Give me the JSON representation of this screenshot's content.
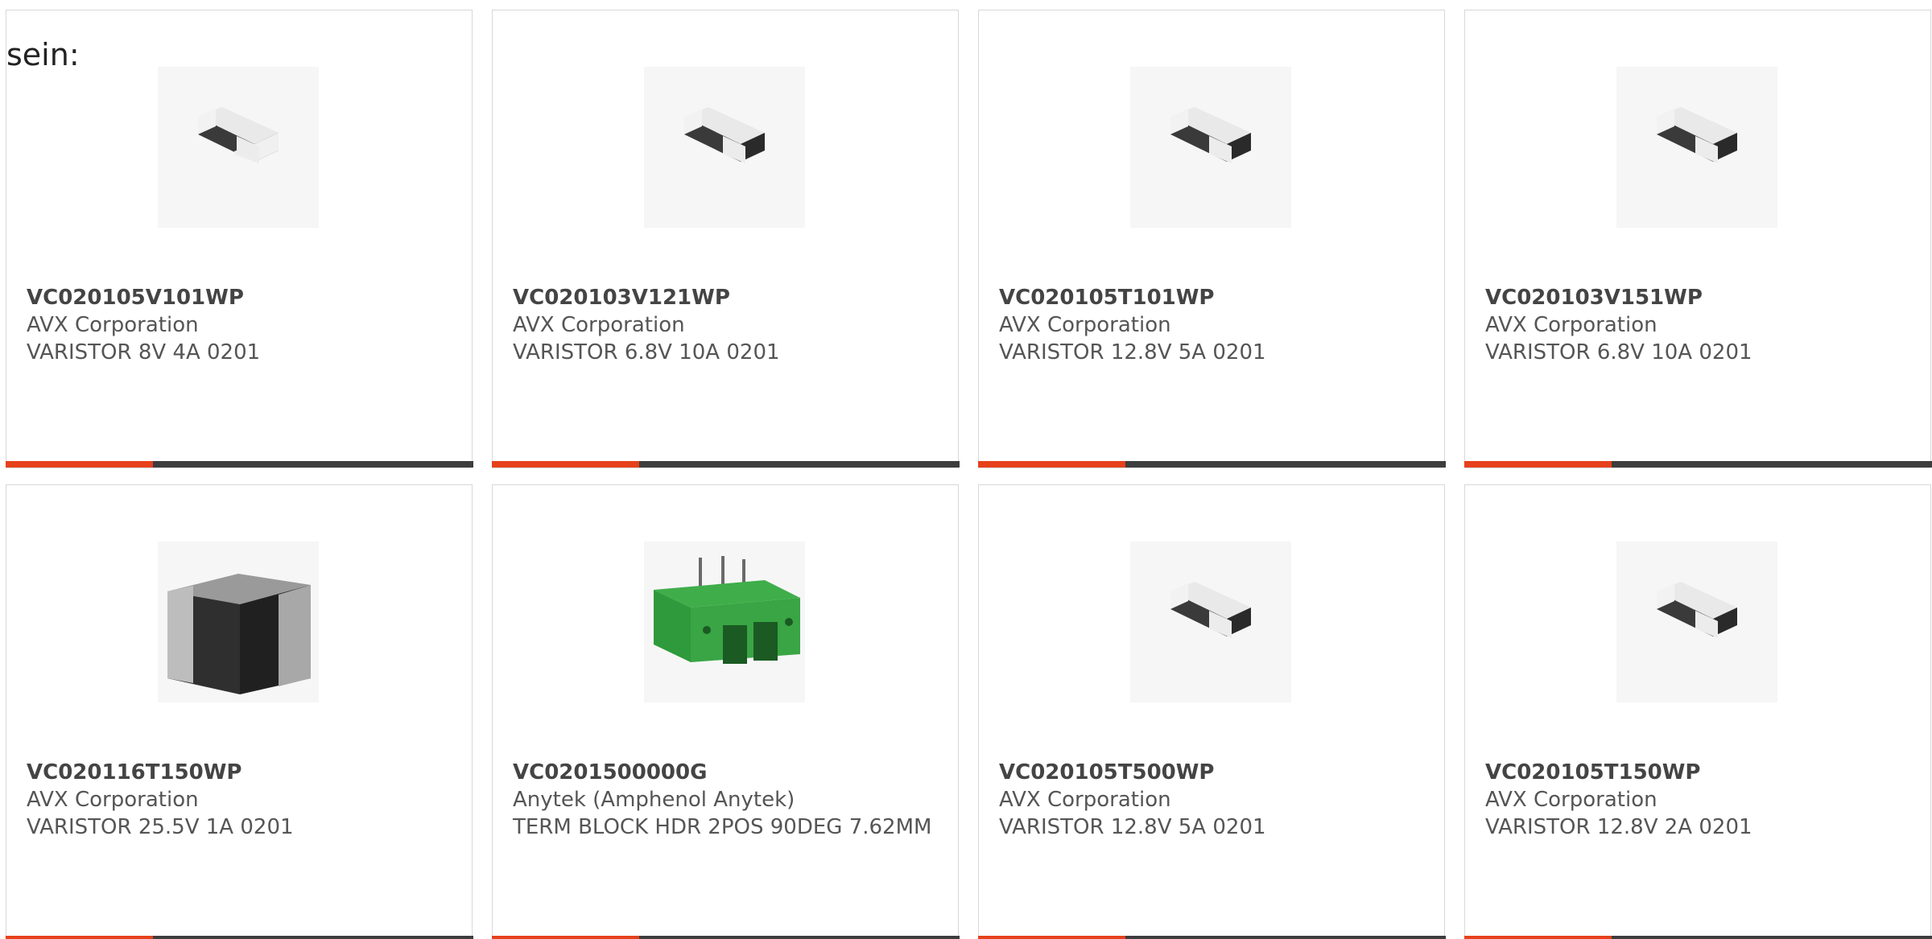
{
  "lead_text": "sein:",
  "colors": {
    "accent": "#e6411b",
    "bar": "#3d3d3d",
    "border": "#d8d8d8"
  },
  "cards": [
    {
      "part": "VC020105V101WP",
      "manufacturer": "AVX Corporation",
      "description": "VARISTOR 8V 4A 0201",
      "icon": "chip-varistor-icon"
    },
    {
      "part": "VC020103V121WP",
      "manufacturer": "AVX Corporation",
      "description": "VARISTOR 6.8V 10A 0201",
      "icon": "chip-varistor-icon"
    },
    {
      "part": "VC020105T101WP",
      "manufacturer": "AVX Corporation",
      "description": "VARISTOR 12.8V 5A 0201",
      "icon": "chip-varistor-icon"
    },
    {
      "part": "VC020103V151WP",
      "manufacturer": "AVX Corporation",
      "description": "VARISTOR 6.8V 10A 0201",
      "icon": "chip-varistor-icon"
    },
    {
      "part": "VC020116T150WP",
      "manufacturer": "AVX Corporation",
      "description": "VARISTOR 25.5V 1A 0201",
      "icon": "chip-varistor-large-icon"
    },
    {
      "part": "VC0201500000G",
      "manufacturer": "Anytek (Amphenol Anytek)",
      "description": "TERM BLOCK HDR 2POS 90DEG 7.62MM",
      "icon": "terminal-block-icon"
    },
    {
      "part": "VC020105T500WP",
      "manufacturer": "AVX Corporation",
      "description": "VARISTOR 12.8V 5A 0201",
      "icon": "chip-varistor-icon"
    },
    {
      "part": "VC020105T150WP",
      "manufacturer": "AVX Corporation",
      "description": "VARISTOR 12.8V 2A 0201",
      "icon": "chip-varistor-icon"
    }
  ]
}
